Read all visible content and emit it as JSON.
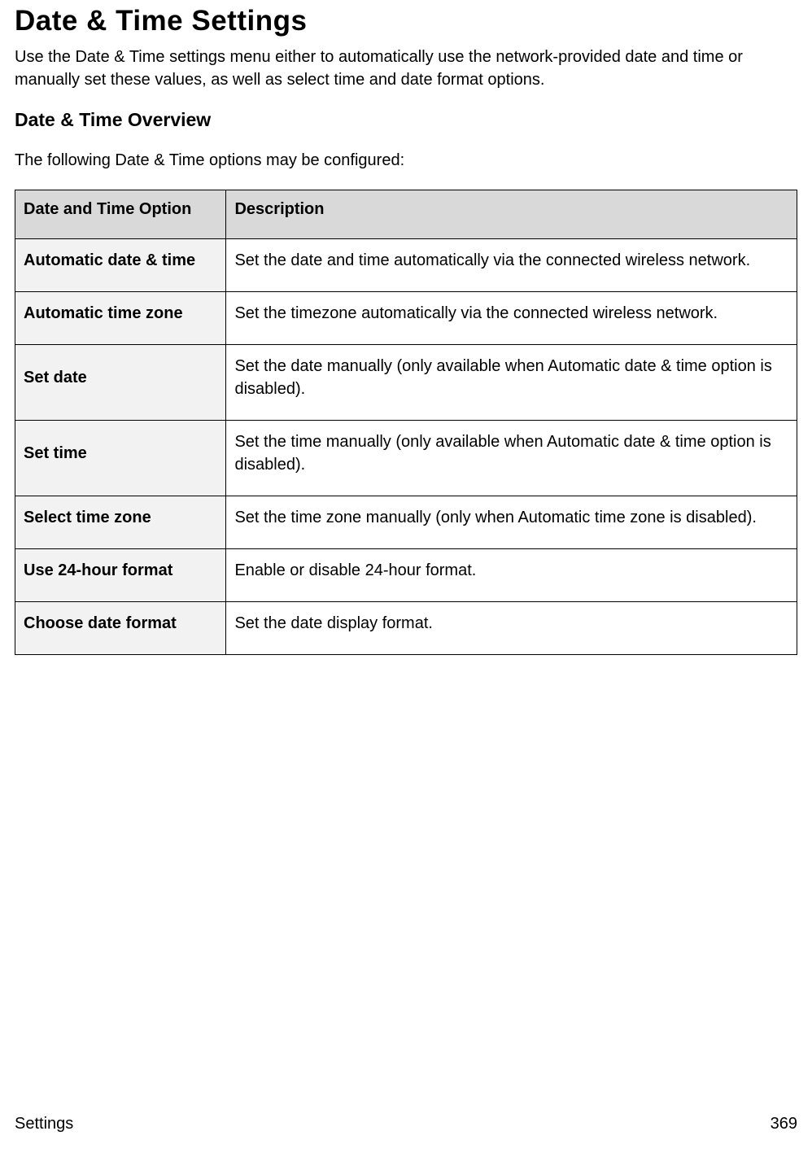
{
  "title": "Date & Time Settings",
  "intro": "Use the Date & Time settings menu either to automatically use the network-provided date and time or manually set these values, as well as select time and date format options.",
  "overview_heading": "Date & Time Overview",
  "overview_intro": "The following Date & Time options may be configured:",
  "table": {
    "header_option": "Date and Time Option",
    "header_description": "Description",
    "rows": [
      {
        "option": "Automatic date & time",
        "description": "Set the date and time automatically via the connected wireless network."
      },
      {
        "option": "Automatic time zone",
        "description": "Set the timezone automatically via the connected wireless network."
      },
      {
        "option": "Set date",
        "description": "Set the date manually (only available when Automatic date & time option is disabled)."
      },
      {
        "option": "Set time",
        "description": "Set the time manually (only available when Automatic date & time option is disabled)."
      },
      {
        "option": "Select time zone",
        "description": "Set the time zone manually (only when Automatic time zone is disabled)."
      },
      {
        "option": "Use 24-hour format",
        "description": "Enable or disable 24-hour format."
      },
      {
        "option": "Choose date format",
        "description": "Set the date display format."
      }
    ]
  },
  "footer": {
    "section": "Settings",
    "page_number": "369"
  }
}
